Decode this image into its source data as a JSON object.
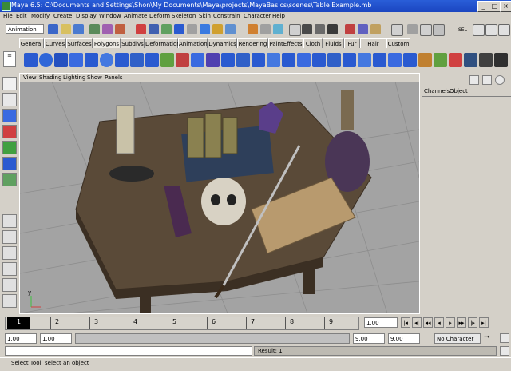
{
  "window": {
    "title": "Maya 6.5: C:\\Documents and Settings\\Shon\\My Documents\\Maya\\projects\\MayaBasics\\scenes\\Table Example.mb"
  },
  "menus": [
    "File",
    "Edit",
    "Modify",
    "Create",
    "Display",
    "Window",
    "Animate",
    "Deform",
    "Skeleton",
    "Skin",
    "Constrain",
    "Character",
    "Help"
  ],
  "toolbar": {
    "mode": "Animation",
    "right_label": "SEL"
  },
  "shelf_tabs": [
    "General",
    "Curves",
    "Surfaces",
    "Polygons",
    "Subdivs",
    "Deformation",
    "Animation",
    "Dynamics",
    "Rendering",
    "PaintEffects",
    "Cloth",
    "Fluids",
    "Fur",
    "Hair",
    "Custom"
  ],
  "shelf_active": "Polygons",
  "viewport": {
    "menu": [
      "View",
      "Shading",
      "Lighting",
      "Show",
      "Panels"
    ],
    "axis_label": "y"
  },
  "channel_box": {
    "tabs": [
      "Channels",
      "Object"
    ]
  },
  "timeline": {
    "ticks": [
      "1",
      "2",
      "3",
      "4",
      "5",
      "6",
      "7",
      "8",
      "9"
    ],
    "current_frame": "1.00"
  },
  "range": {
    "start": "1.00",
    "inner_start": "1.00",
    "inner_end": "9.00",
    "end": "9.00",
    "character_set": "No Character Set"
  },
  "command": {
    "result": "Result: 1"
  },
  "help_line": "Select Tool: select an object"
}
